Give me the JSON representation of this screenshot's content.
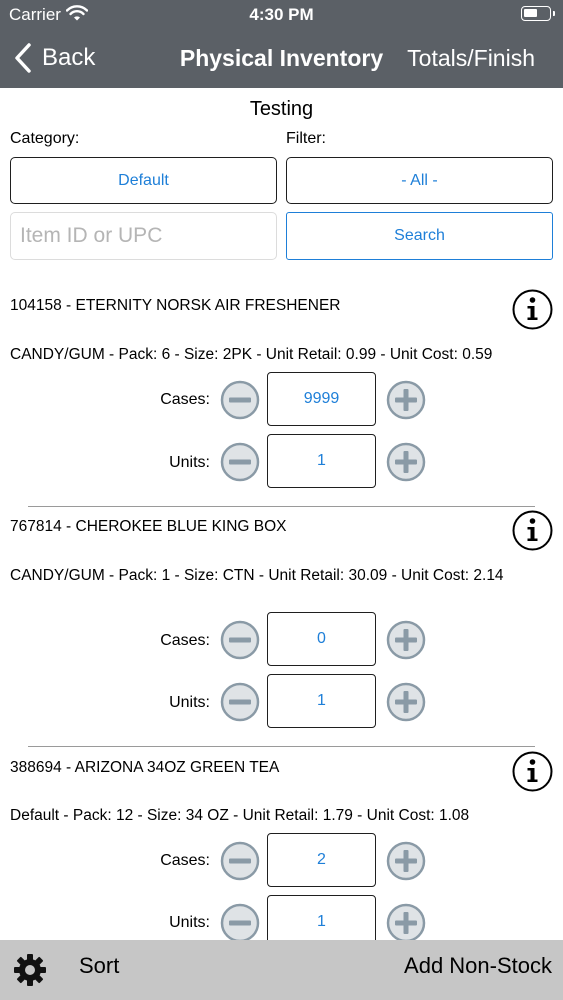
{
  "status_bar": {
    "carrier": "Carrier",
    "time": "4:30 PM"
  },
  "nav": {
    "back_label": "Back",
    "title": "Physical Inventory",
    "right_label": "Totals/Finish"
  },
  "store_title": "Testing",
  "filters": {
    "category_label": "Category:",
    "category_value": "Default",
    "filter_label": "Filter:",
    "filter_value": "- All -"
  },
  "search": {
    "placeholder": "Item ID or UPC",
    "button_label": "Search"
  },
  "qty_labels": {
    "cases": "Cases:",
    "units": "Units:"
  },
  "items": [
    {
      "title": "104158 - ETERNITY NORSK AIR FRESHENER",
      "desc": "CANDY/GUM - Pack: 6 - Size: 2PK - Unit Retail: 0.99 - Unit Cost: 0.59",
      "cases": "9999",
      "units": "1"
    },
    {
      "title": "767814 - CHEROKEE BLUE KING BOX",
      "desc": "CANDY/GUM - Pack: 1 - Size:  CTN - Unit Retail: 30.09 - Unit Cost: 2.14",
      "cases": "0",
      "units": "1"
    },
    {
      "title": "388694 - ARIZONA 34OZ GREEN TEA",
      "desc": "Default - Pack: 12 - Size: 34 OZ - Unit Retail: 1.79 - Unit Cost: 1.08",
      "cases": "2",
      "units": "1"
    }
  ],
  "bottom": {
    "sort_label": "Sort",
    "add_label": "Add Non-Stock"
  },
  "icons": {
    "back": "chevron-left-icon",
    "wifi": "wifi-icon",
    "battery": "battery-icon",
    "info": "info-icon",
    "minus": "minus-circle-icon",
    "plus": "plus-circle-icon",
    "settings": "gear-icon"
  },
  "colors": {
    "nav_bar": "#5b6066",
    "accent": "#1e7fd8",
    "bottom_bar": "#c6c6c6",
    "stepper_fill": "#dfe3e6",
    "stepper_stroke": "#8a9aa6"
  }
}
